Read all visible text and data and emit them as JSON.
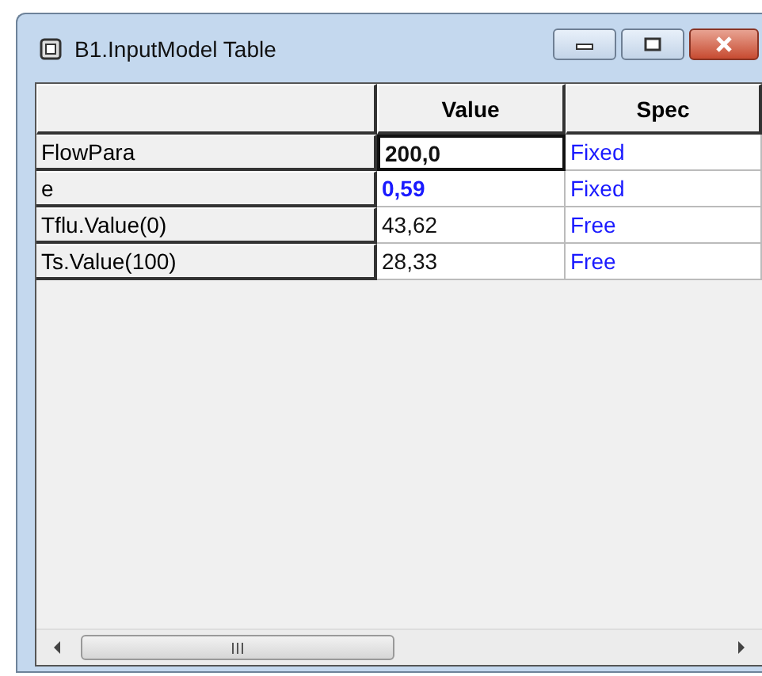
{
  "window": {
    "title": "B1.InputModel Table"
  },
  "table": {
    "columns": [
      "Value",
      "Spec"
    ],
    "rows": [
      {
        "name": "FlowPara",
        "value": "200,0",
        "spec": "Fixed",
        "selected": true,
        "kind": "current"
      },
      {
        "name": "e",
        "value": "0,59",
        "spec": "Fixed",
        "selected": false,
        "kind": "modified"
      },
      {
        "name": "Tflu.Value(0)",
        "value": "43,62",
        "spec": "Free",
        "selected": false,
        "kind": "plain"
      },
      {
        "name": "Ts.Value(100)",
        "value": "28,33",
        "spec": "Free",
        "selected": false,
        "kind": "plain"
      }
    ]
  }
}
